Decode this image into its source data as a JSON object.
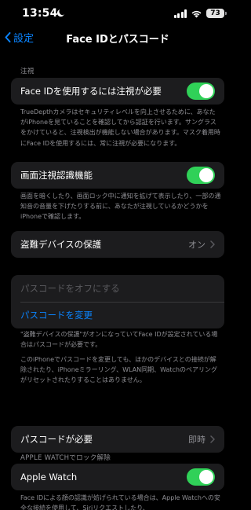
{
  "status": {
    "time": "13:54",
    "battery": "73"
  },
  "nav": {
    "back_label": "設定",
    "title": "Face IDとパスコード"
  },
  "attention": {
    "header": "注視",
    "require_label": "Face IDを使用するには注視が必要",
    "require_on": true,
    "description": "TrueDepthカメラはセキュリティレベルを向上させるために、あなたがiPhoneを見ていることを確認してから認証を行います。サングラスをかけていると、注視検出が機能しない場合があります。マスク着用時にFace IDを使用するには、常に注視が必要になります。",
    "aware_label": "画面注視認識機能",
    "aware_on": true,
    "aware_description": "画面を暗くしたり、画面ロック中に通知を拡げて表示したり、一部の通知音の音量を下げたりする前に、あなたが注視しているかどうかをiPhoneで確認します。"
  },
  "stolen_device": {
    "label": "盗難デバイスの保護",
    "value": "オン"
  },
  "passcode": {
    "turn_off_label": "パスコードをオフにする",
    "change_label": "パスコードを変更",
    "note1": "\"盗難デバイスの保護\"がオンになっていてFace IDが設定されている場合はパスコードが必要です。",
    "note2": "このiPhoneでパスコードを変更しても、ほかのデバイスとの接続が解除されたり、iPhoneミラーリング、WLAN同期、Watchのペアリングがリセットされたりすることはありません。",
    "require_label": "パスコードが必要",
    "require_value": "即時"
  },
  "watch": {
    "header": "APPLE WATCHでロック解除",
    "label": "Apple Watch",
    "on": true,
    "description": "Face IDによる顔の認識が妨げられている場合は、Apple Watchへの安全な接続を使用して、Siriリクエストしたり、"
  },
  "colors": {
    "accent": "#0a84ff",
    "toggle_on": "#30d158",
    "cell_bg": "#1c1c1e",
    "secondary_text": "#8e8e93"
  },
  "icons": {
    "back": "chevron-left-icon",
    "disclosure": "chevron-right-icon",
    "moon": "moon-icon",
    "wifi": "wifi-icon",
    "signal": "signal-icon"
  }
}
